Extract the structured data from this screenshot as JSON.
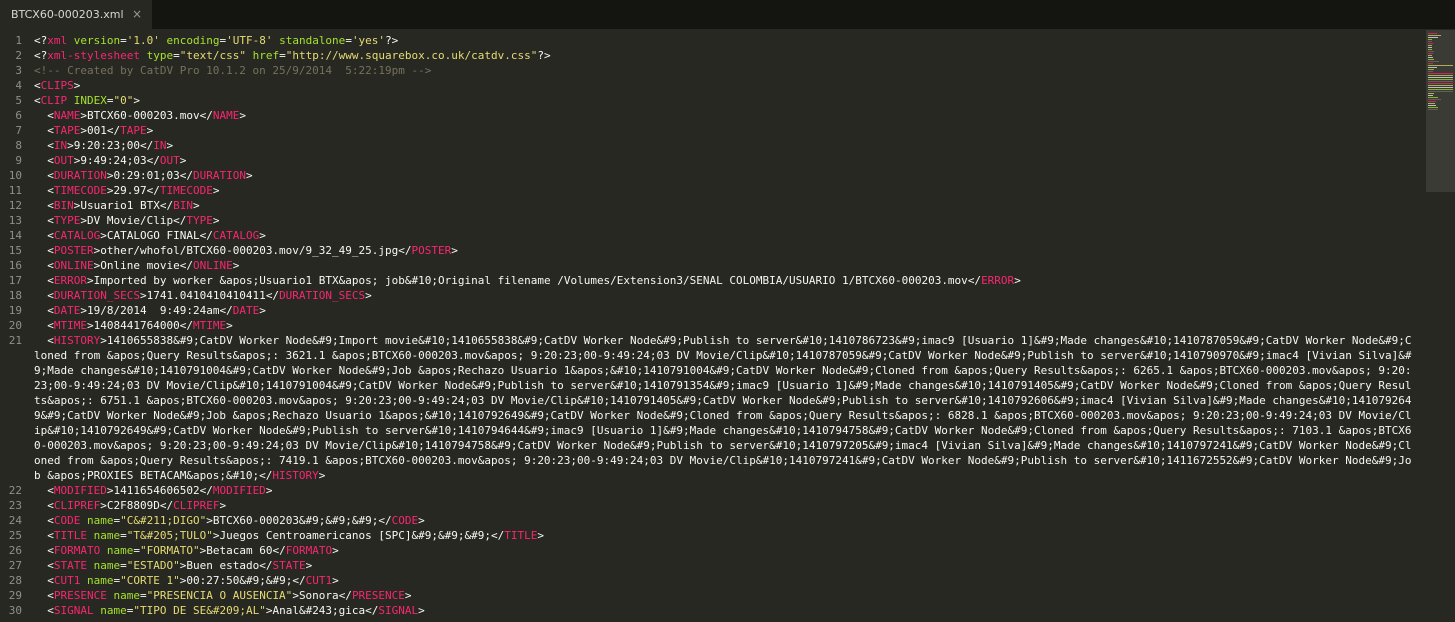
{
  "tab": {
    "title": "BTCX60-000203.xml",
    "close": "×"
  },
  "colors": {
    "background": "#272822",
    "tag": "#f92672",
    "attribute": "#a6e22e",
    "string": "#e6db74",
    "comment": "#75715e",
    "text": "#f8f8f2",
    "line_number": "#8f908a"
  },
  "lines": [
    {
      "n": "1",
      "s": [
        [
          "p",
          "<?"
        ],
        [
          "tag",
          "xml"
        ],
        [
          "t",
          " "
        ],
        [
          "attr",
          "version"
        ],
        [
          "p",
          "="
        ],
        [
          "str",
          "'1.0'"
        ],
        [
          "t",
          " "
        ],
        [
          "attr",
          "encoding"
        ],
        [
          "p",
          "="
        ],
        [
          "str",
          "'UTF-8'"
        ],
        [
          "t",
          " "
        ],
        [
          "attr",
          "standalone"
        ],
        [
          "p",
          "="
        ],
        [
          "str",
          "'yes'"
        ],
        [
          "p",
          "?>"
        ]
      ]
    },
    {
      "n": "2",
      "s": [
        [
          "p",
          "<?"
        ],
        [
          "tag",
          "xml-stylesheet"
        ],
        [
          "t",
          " "
        ],
        [
          "attr",
          "type"
        ],
        [
          "p",
          "="
        ],
        [
          "str",
          "\"text/css\""
        ],
        [
          "t",
          " "
        ],
        [
          "attr",
          "href"
        ],
        [
          "p",
          "="
        ],
        [
          "str",
          "\"http://www.squarebox.co.uk/catdv.css\""
        ],
        [
          "p",
          "?>"
        ]
      ]
    },
    {
      "n": "3",
      "s": [
        [
          "c",
          "<!-- Created by CatDV Pro 10.1.2 on 25/9/2014  5:22:19pm -->"
        ]
      ]
    },
    {
      "n": "4",
      "s": [
        [
          "p",
          "<"
        ],
        [
          "tag",
          "CLIPS"
        ],
        [
          "p",
          ">"
        ]
      ]
    },
    {
      "n": "5",
      "s": [
        [
          "p",
          "<"
        ],
        [
          "tag",
          "CLIP"
        ],
        [
          "t",
          " "
        ],
        [
          "attr",
          "INDEX"
        ],
        [
          "p",
          "="
        ],
        [
          "str",
          "\"0\""
        ],
        [
          "p",
          ">"
        ]
      ]
    },
    {
      "n": "6",
      "s": [
        [
          "t",
          "  "
        ],
        [
          "p",
          "<"
        ],
        [
          "tag",
          "NAME"
        ],
        [
          "p",
          ">"
        ],
        [
          "t",
          "BTCX60-000203.mov"
        ],
        [
          "p",
          "</"
        ],
        [
          "tag",
          "NAME"
        ],
        [
          "p",
          ">"
        ]
      ]
    },
    {
      "n": "7",
      "s": [
        [
          "t",
          "  "
        ],
        [
          "p",
          "<"
        ],
        [
          "tag",
          "TAPE"
        ],
        [
          "p",
          ">"
        ],
        [
          "t",
          "001"
        ],
        [
          "p",
          "</"
        ],
        [
          "tag",
          "TAPE"
        ],
        [
          "p",
          ">"
        ]
      ]
    },
    {
      "n": "8",
      "s": [
        [
          "t",
          "  "
        ],
        [
          "p",
          "<"
        ],
        [
          "tag",
          "IN"
        ],
        [
          "p",
          ">"
        ],
        [
          "t",
          "9:20:23;00"
        ],
        [
          "p",
          "</"
        ],
        [
          "tag",
          "IN"
        ],
        [
          "p",
          ">"
        ]
      ]
    },
    {
      "n": "9",
      "s": [
        [
          "t",
          "  "
        ],
        [
          "p",
          "<"
        ],
        [
          "tag",
          "OUT"
        ],
        [
          "p",
          ">"
        ],
        [
          "t",
          "9:49:24;03"
        ],
        [
          "p",
          "</"
        ],
        [
          "tag",
          "OUT"
        ],
        [
          "p",
          ">"
        ]
      ]
    },
    {
      "n": "10",
      "s": [
        [
          "t",
          "  "
        ],
        [
          "p",
          "<"
        ],
        [
          "tag",
          "DURATION"
        ],
        [
          "p",
          ">"
        ],
        [
          "t",
          "0:29:01;03"
        ],
        [
          "p",
          "</"
        ],
        [
          "tag",
          "DURATION"
        ],
        [
          "p",
          ">"
        ]
      ]
    },
    {
      "n": "11",
      "s": [
        [
          "t",
          "  "
        ],
        [
          "p",
          "<"
        ],
        [
          "tag",
          "TIMECODE"
        ],
        [
          "p",
          ">"
        ],
        [
          "t",
          "29.97"
        ],
        [
          "p",
          "</"
        ],
        [
          "tag",
          "TIMECODE"
        ],
        [
          "p",
          ">"
        ]
      ]
    },
    {
      "n": "12",
      "s": [
        [
          "t",
          "  "
        ],
        [
          "p",
          "<"
        ],
        [
          "tag",
          "BIN"
        ],
        [
          "p",
          ">"
        ],
        [
          "t",
          "Usuario1 BTX"
        ],
        [
          "p",
          "</"
        ],
        [
          "tag",
          "BIN"
        ],
        [
          "p",
          ">"
        ]
      ]
    },
    {
      "n": "13",
      "s": [
        [
          "t",
          "  "
        ],
        [
          "p",
          "<"
        ],
        [
          "tag",
          "TYPE"
        ],
        [
          "p",
          ">"
        ],
        [
          "t",
          "DV Movie/Clip"
        ],
        [
          "p",
          "</"
        ],
        [
          "tag",
          "TYPE"
        ],
        [
          "p",
          ">"
        ]
      ]
    },
    {
      "n": "14",
      "s": [
        [
          "t",
          "  "
        ],
        [
          "p",
          "<"
        ],
        [
          "tag",
          "CATALOG"
        ],
        [
          "p",
          ">"
        ],
        [
          "t",
          "CATALOGO FINAL"
        ],
        [
          "p",
          "</"
        ],
        [
          "tag",
          "CATALOG"
        ],
        [
          "p",
          ">"
        ]
      ]
    },
    {
      "n": "15",
      "s": [
        [
          "t",
          "  "
        ],
        [
          "p",
          "<"
        ],
        [
          "tag",
          "POSTER"
        ],
        [
          "p",
          ">"
        ],
        [
          "t",
          "other/whofol/BTCX60-000203.mov/9_32_49_25.jpg"
        ],
        [
          "p",
          "</"
        ],
        [
          "tag",
          "POSTER"
        ],
        [
          "p",
          ">"
        ]
      ]
    },
    {
      "n": "16",
      "s": [
        [
          "t",
          "  "
        ],
        [
          "p",
          "<"
        ],
        [
          "tag",
          "ONLINE"
        ],
        [
          "p",
          ">"
        ],
        [
          "t",
          "Online movie"
        ],
        [
          "p",
          "</"
        ],
        [
          "tag",
          "ONLINE"
        ],
        [
          "p",
          ">"
        ]
      ]
    },
    {
      "n": "17",
      "s": [
        [
          "t",
          "  "
        ],
        [
          "p",
          "<"
        ],
        [
          "tag",
          "ERROR"
        ],
        [
          "p",
          ">"
        ],
        [
          "t",
          "Imported by worker &apos;Usuario1 BTX&apos; job&#10;Original filename /Volumes/Extension3/SENAL COLOMBIA/USUARIO 1/BTCX60-000203.mov"
        ],
        [
          "p",
          "</"
        ],
        [
          "tag",
          "ERROR"
        ],
        [
          "p",
          ">"
        ]
      ]
    },
    {
      "n": "18",
      "s": [
        [
          "t",
          "  "
        ],
        [
          "p",
          "<"
        ],
        [
          "tag",
          "DURATION_SECS"
        ],
        [
          "p",
          ">"
        ],
        [
          "t",
          "1741.0410410410411"
        ],
        [
          "p",
          "</"
        ],
        [
          "tag",
          "DURATION_SECS"
        ],
        [
          "p",
          ">"
        ]
      ]
    },
    {
      "n": "19",
      "s": [
        [
          "t",
          "  "
        ],
        [
          "p",
          "<"
        ],
        [
          "tag",
          "DATE"
        ],
        [
          "p",
          ">"
        ],
        [
          "t",
          "19/8/2014  9:49:24am"
        ],
        [
          "p",
          "</"
        ],
        [
          "tag",
          "DATE"
        ],
        [
          "p",
          ">"
        ]
      ]
    },
    {
      "n": "20",
      "s": [
        [
          "t",
          "  "
        ],
        [
          "p",
          "<"
        ],
        [
          "tag",
          "MTIME"
        ],
        [
          "p",
          ">"
        ],
        [
          "t",
          "1408441764000"
        ],
        [
          "p",
          "</"
        ],
        [
          "tag",
          "MTIME"
        ],
        [
          "p",
          ">"
        ]
      ]
    },
    {
      "n": "21",
      "s": [
        [
          "t",
          "  "
        ],
        [
          "p",
          "<"
        ],
        [
          "tag",
          "HISTORY"
        ],
        [
          "p",
          ">"
        ],
        [
          "t",
          "1410655838&#9;CatDV Worker Node&#9;Import movie&#10;1410655838&#9;CatDV Worker Node&#9;Publish to server&#10;1410786723&#9;imac9 [Usuario 1]&#9;Made changes&#10;1410787059&#9;CatDV Worker Node&#9;Cloned from &apos;Query Results&apos;: 3621.1 &apos;BTCX60-000203.mov&apos; 9:20:23;00-9:49:24;03 DV Movie/Clip&#10;1410787059&#9;CatDV Worker Node&#9;Publish to server&#10;1410790970&#9;imac4 [Vivian Silva]&#9;Made changes&#10;1410791004&#9;CatDV Worker Node&#9;Job &apos;Rechazo Usuario 1&apos;&#10;1410791004&#9;CatDV Worker Node&#9;Cloned from &apos;Query Results&apos;: 6265.1 &apos;BTCX60-000203.mov&apos; 9:20:23;00-9:49:24;03 DV Movie/Clip&#10;1410791004&#9;CatDV Worker Node&#9;Publish to server&#10;1410791354&#9;imac9 [Usuario 1]&#9;Made changes&#10;1410791405&#9;CatDV Worker Node&#9;Cloned from &apos;Query Results&apos;: 6751.1 &apos;BTCX60-000203.mov&apos; 9:20:23;00-9:49:24;03 DV Movie/Clip&#10;1410791405&#9;CatDV Worker Node&#9;Publish to server&#10;1410792606&#9;imac4 [Vivian Silva]&#9;Made changes&#10;1410792649&#9;CatDV Worker Node&#9;Job &apos;Rechazo Usuario 1&apos;&#10;1410792649&#9;CatDV Worker Node&#9;Cloned from &apos;Query Results&apos;: 6828.1 &apos;BTCX60-000203.mov&apos; 9:20:23;00-9:49:24;03 DV Movie/Clip&#10;1410792649&#9;CatDV Worker Node&#9;Publish to server&#10;1410794644&#9;imac9 [Usuario 1]&#9;Made changes&#10;1410794758&#9;CatDV Worker Node&#9;Cloned from &apos;Query Results&apos;: 7103.1 &apos;BTCX60-000203.mov&apos; 9:20:23;00-9:49:24;03 DV Movie/Clip&#10;1410794758&#9;CatDV Worker Node&#9;Publish to server&#10;1410797205&#9;imac4 [Vivian Silva]&#9;Made changes&#10;1410797241&#9;CatDV Worker Node&#9;Cloned from &apos;Query Results&apos;: 7419.1 &apos;BTCX60-000203.mov&apos; 9:20:23;00-9:49:24;03 DV Movie/Clip&#10;1410797241&#9;CatDV Worker Node&#9;Publish to server&#10;1411672552&#9;CatDV Worker Node&#9;Job &apos;PROXIES BETACAM&apos;&#10;"
        ],
        [
          "p",
          "</"
        ],
        [
          "tag",
          "HISTORY"
        ],
        [
          "p",
          ">"
        ]
      ]
    },
    {
      "n": "22",
      "s": [
        [
          "t",
          "  "
        ],
        [
          "p",
          "<"
        ],
        [
          "tag",
          "MODIFIED"
        ],
        [
          "p",
          ">"
        ],
        [
          "t",
          "1411654606502"
        ],
        [
          "p",
          "</"
        ],
        [
          "tag",
          "MODIFIED"
        ],
        [
          "p",
          ">"
        ]
      ]
    },
    {
      "n": "23",
      "s": [
        [
          "t",
          "  "
        ],
        [
          "p",
          "<"
        ],
        [
          "tag",
          "CLIPREF"
        ],
        [
          "p",
          ">"
        ],
        [
          "t",
          "C2F8809D"
        ],
        [
          "p",
          "</"
        ],
        [
          "tag",
          "CLIPREF"
        ],
        [
          "p",
          ">"
        ]
      ]
    },
    {
      "n": "24",
      "s": [
        [
          "t",
          "  "
        ],
        [
          "p",
          "<"
        ],
        [
          "tag",
          "CODE"
        ],
        [
          "t",
          " "
        ],
        [
          "attr",
          "name"
        ],
        [
          "p",
          "="
        ],
        [
          "str",
          "\"C&#211;DIGO\""
        ],
        [
          "p",
          ">"
        ],
        [
          "t",
          "BTCX60-000203&#9;&#9;&#9;"
        ],
        [
          "p",
          "</"
        ],
        [
          "tag",
          "CODE"
        ],
        [
          "p",
          ">"
        ]
      ]
    },
    {
      "n": "25",
      "s": [
        [
          "t",
          "  "
        ],
        [
          "p",
          "<"
        ],
        [
          "tag",
          "TITLE"
        ],
        [
          "t",
          " "
        ],
        [
          "attr",
          "name"
        ],
        [
          "p",
          "="
        ],
        [
          "str",
          "\"T&#205;TULO\""
        ],
        [
          "p",
          ">"
        ],
        [
          "t",
          "Juegos Centroamericanos [SPC]&#9;&#9;&#9;"
        ],
        [
          "p",
          "</"
        ],
        [
          "tag",
          "TITLE"
        ],
        [
          "p",
          ">"
        ]
      ]
    },
    {
      "n": "26",
      "s": [
        [
          "t",
          "  "
        ],
        [
          "p",
          "<"
        ],
        [
          "tag",
          "FORMATO"
        ],
        [
          "t",
          " "
        ],
        [
          "attr",
          "name"
        ],
        [
          "p",
          "="
        ],
        [
          "str",
          "\"FORMATO\""
        ],
        [
          "p",
          ">"
        ],
        [
          "t",
          "Betacam 60"
        ],
        [
          "p",
          "</"
        ],
        [
          "tag",
          "FORMATO"
        ],
        [
          "p",
          ">"
        ]
      ]
    },
    {
      "n": "27",
      "s": [
        [
          "t",
          "  "
        ],
        [
          "p",
          "<"
        ],
        [
          "tag",
          "STATE"
        ],
        [
          "t",
          " "
        ],
        [
          "attr",
          "name"
        ],
        [
          "p",
          "="
        ],
        [
          "str",
          "\"ESTADO\""
        ],
        [
          "p",
          ">"
        ],
        [
          "t",
          "Buen estado"
        ],
        [
          "p",
          "</"
        ],
        [
          "tag",
          "STATE"
        ],
        [
          "p",
          ">"
        ]
      ]
    },
    {
      "n": "28",
      "s": [
        [
          "t",
          "  "
        ],
        [
          "p",
          "<"
        ],
        [
          "tag",
          "CUT1"
        ],
        [
          "t",
          " "
        ],
        [
          "attr",
          "name"
        ],
        [
          "p",
          "="
        ],
        [
          "str",
          "\"CORTE 1\""
        ],
        [
          "p",
          ">"
        ],
        [
          "t",
          "00:27:50&#9;&#9;"
        ],
        [
          "p",
          "</"
        ],
        [
          "tag",
          "CUT1"
        ],
        [
          "p",
          ">"
        ]
      ]
    },
    {
      "n": "29",
      "s": [
        [
          "t",
          "  "
        ],
        [
          "p",
          "<"
        ],
        [
          "tag",
          "PRESENCE"
        ],
        [
          "t",
          " "
        ],
        [
          "attr",
          "name"
        ],
        [
          "p",
          "="
        ],
        [
          "str",
          "\"PRESENCIA O AUSENCIA\""
        ],
        [
          "p",
          ">"
        ],
        [
          "t",
          "Sonora"
        ],
        [
          "p",
          "</"
        ],
        [
          "tag",
          "PRESENCE"
        ],
        [
          "p",
          ">"
        ]
      ]
    },
    {
      "n": "30",
      "s": [
        [
          "t",
          "  "
        ],
        [
          "p",
          "<"
        ],
        [
          "tag",
          "SIGNAL"
        ],
        [
          "t",
          " "
        ],
        [
          "attr",
          "name"
        ],
        [
          "p",
          "="
        ],
        [
          "str",
          "\"TIPO DE SE&#209;AL\""
        ],
        [
          "p",
          ">"
        ],
        [
          "t",
          "Anal&#243;gica"
        ],
        [
          "p",
          "</"
        ],
        [
          "tag",
          "SIGNAL"
        ],
        [
          "p",
          ">"
        ]
      ]
    }
  ]
}
